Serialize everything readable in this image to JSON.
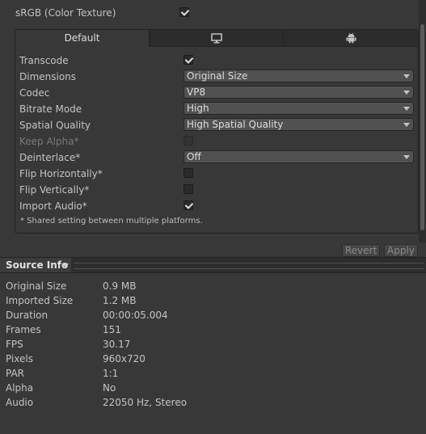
{
  "srgb": {
    "label": "sRGB (Color Texture)",
    "checked": true
  },
  "tabs": [
    {
      "label": "Default",
      "icon": ""
    },
    {
      "label": "",
      "icon": "monitor-icon"
    },
    {
      "label": "",
      "icon": "android-icon"
    }
  ],
  "settings": {
    "transcode": {
      "label": "Transcode",
      "checked": true
    },
    "dimensions": {
      "label": "Dimensions",
      "value": "Original Size"
    },
    "codec": {
      "label": "Codec",
      "value": "VP8"
    },
    "bitrate_mode": {
      "label": "Bitrate Mode",
      "value": "High"
    },
    "spatial_quality": {
      "label": "Spatial Quality",
      "value": "High Spatial Quality"
    },
    "keep_alpha": {
      "label": "Keep Alpha*",
      "checked": false
    },
    "deinterlace": {
      "label": "Deinterlace*",
      "value": "Off"
    },
    "flip_horizontally": {
      "label": "Flip Horizontally*",
      "checked": false
    },
    "flip_vertically": {
      "label": "Flip Vertically*",
      "checked": false
    },
    "import_audio": {
      "label": "Import Audio*",
      "checked": true
    },
    "footnote": "* Shared setting between multiple platforms."
  },
  "buttons": {
    "revert": "Revert",
    "apply": "Apply"
  },
  "source_info": {
    "title": "Source Info",
    "rows": [
      {
        "label": "Original Size",
        "value": "0.9 MB"
      },
      {
        "label": "Imported Size",
        "value": "1.2 MB"
      },
      {
        "label": "Duration",
        "value": "00:00:05.004"
      },
      {
        "label": "Frames",
        "value": "151"
      },
      {
        "label": "FPS",
        "value": "30.17"
      },
      {
        "label": "Pixels",
        "value": "960x720"
      },
      {
        "label": "PAR",
        "value": "1:1"
      },
      {
        "label": "Alpha",
        "value": "No"
      },
      {
        "label": "Audio",
        "value": "22050 Hz, Stereo"
      }
    ]
  },
  "colors": {
    "background": "#383838",
    "text": "#c4c4c4",
    "field": "#515151"
  }
}
